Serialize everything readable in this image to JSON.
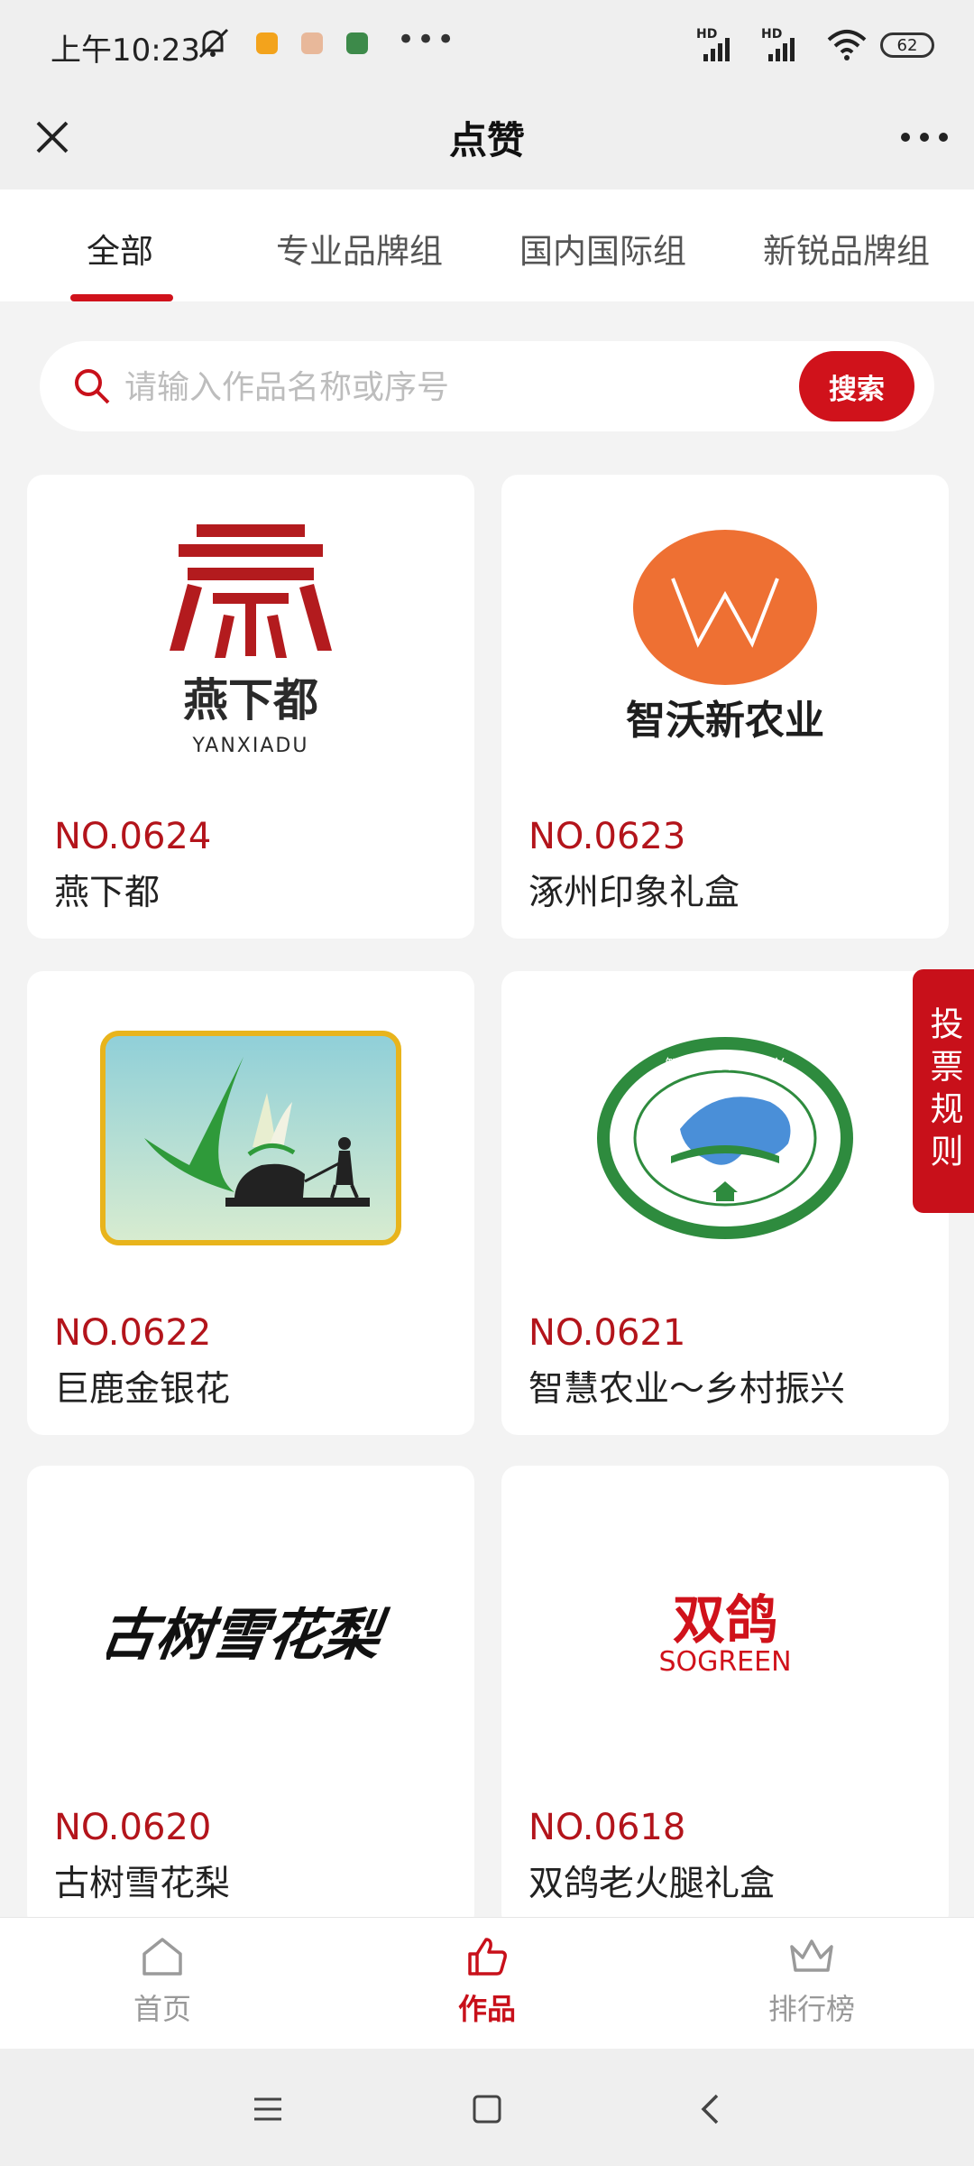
{
  "status_bar": {
    "time": "上午10:23",
    "battery": "62",
    "network_labels": [
      "HD",
      "HD"
    ]
  },
  "nav": {
    "title": "点赞"
  },
  "tabs": [
    {
      "label": "全部",
      "active": true
    },
    {
      "label": "专业品牌组",
      "active": false
    },
    {
      "label": "国内国际组",
      "active": false
    },
    {
      "label": "新锐品牌组",
      "active": false
    }
  ],
  "search": {
    "placeholder": "请输入作品名称或序号",
    "value": "",
    "button_label": "搜索"
  },
  "cards": [
    {
      "no": "NO.0624",
      "name": "燕下都",
      "logo": {
        "text": "燕下都",
        "sub": "YANXIADU"
      }
    },
    {
      "no": "NO.0623",
      "name": "涿州印象礼盒",
      "logo": {
        "text": "智沃新农业"
      }
    },
    {
      "no": "NO.0622",
      "name": "巨鹿金银花",
      "logo": {}
    },
    {
      "no": "NO.0621",
      "name": "智慧农业～乡村振兴",
      "logo": {
        "text": "智慧农业 乡村振兴"
      }
    },
    {
      "no": "NO.0620",
      "name": "古树雪花梨",
      "logo": {
        "text": "古树雪花梨"
      }
    },
    {
      "no": "NO.0618",
      "name": "双鸽老火腿礼盒",
      "logo": {
        "text": "双鸽",
        "sub": "SOGREEN"
      }
    }
  ],
  "side_button": {
    "label": "投票规则"
  },
  "bottom_tabs": [
    {
      "label": "首页",
      "icon": "home-icon",
      "active": false
    },
    {
      "label": "作品",
      "icon": "thumbs-up-icon",
      "active": true
    },
    {
      "label": "排行榜",
      "icon": "crown-icon",
      "active": false
    }
  ],
  "colors": {
    "accent": "#d0121b",
    "no_text": "#b3141b",
    "orange_logo": "#ee7033",
    "green_logo": "#2e8b3e"
  }
}
